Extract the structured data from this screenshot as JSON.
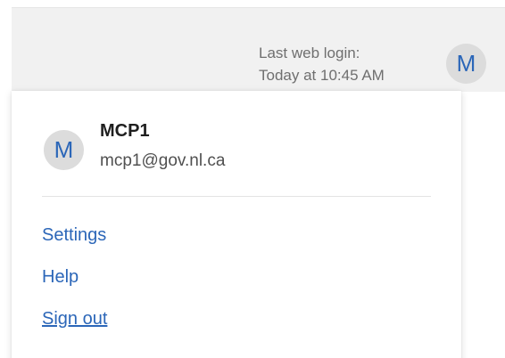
{
  "header": {
    "last_login_label": "Last web login:",
    "last_login_time": "Today at 10:45 AM",
    "avatar_initial": "M"
  },
  "profile": {
    "avatar_initial": "M",
    "name": "MCP1",
    "email": "mcp1@gov.nl.ca"
  },
  "menu": {
    "items": [
      {
        "label": "Settings"
      },
      {
        "label": "Help"
      },
      {
        "label": "Sign out"
      }
    ]
  },
  "colors": {
    "link": "#2b66b8",
    "header_background": "#f1f1f1",
    "avatar_background": "#dcdcdc",
    "text_secondary": "#6f6f6f"
  }
}
